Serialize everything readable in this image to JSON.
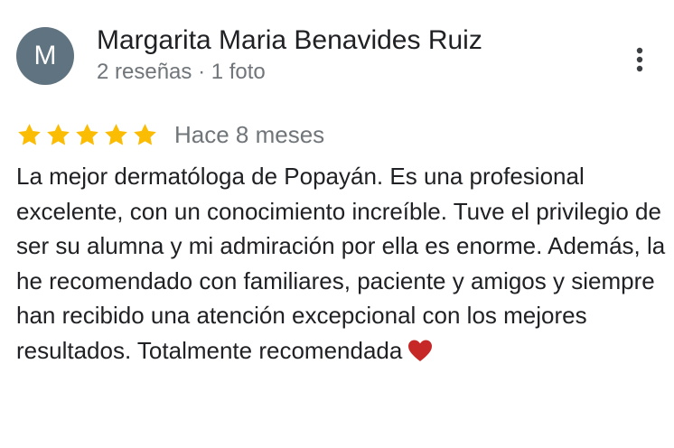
{
  "review": {
    "author": {
      "initial": "M",
      "avatar_color": "#5f7380",
      "name": "Margarita Maria Benavides Ruiz",
      "meta": "2 reseñas · 1 foto"
    },
    "menu_icon": "more-vert-icon",
    "rating": {
      "stars": 5,
      "out_of": 5,
      "star_color": "#fbbc04",
      "time": "Hace 8 meses"
    },
    "text": "La mejor dermatóloga de Popayán. Es una profesional excelente, con un conocimiento increíble. Tuve el privilegio de ser su alumna y mi admiración por ella es enorme. Además, la he recomendado con familiares, paciente y amigos y siempre han recibido una atención excepcional con los mejores resultados. Totalmente recomendada",
    "emoji_icon": "red-heart-icon",
    "emoji_color": "#c62828"
  }
}
